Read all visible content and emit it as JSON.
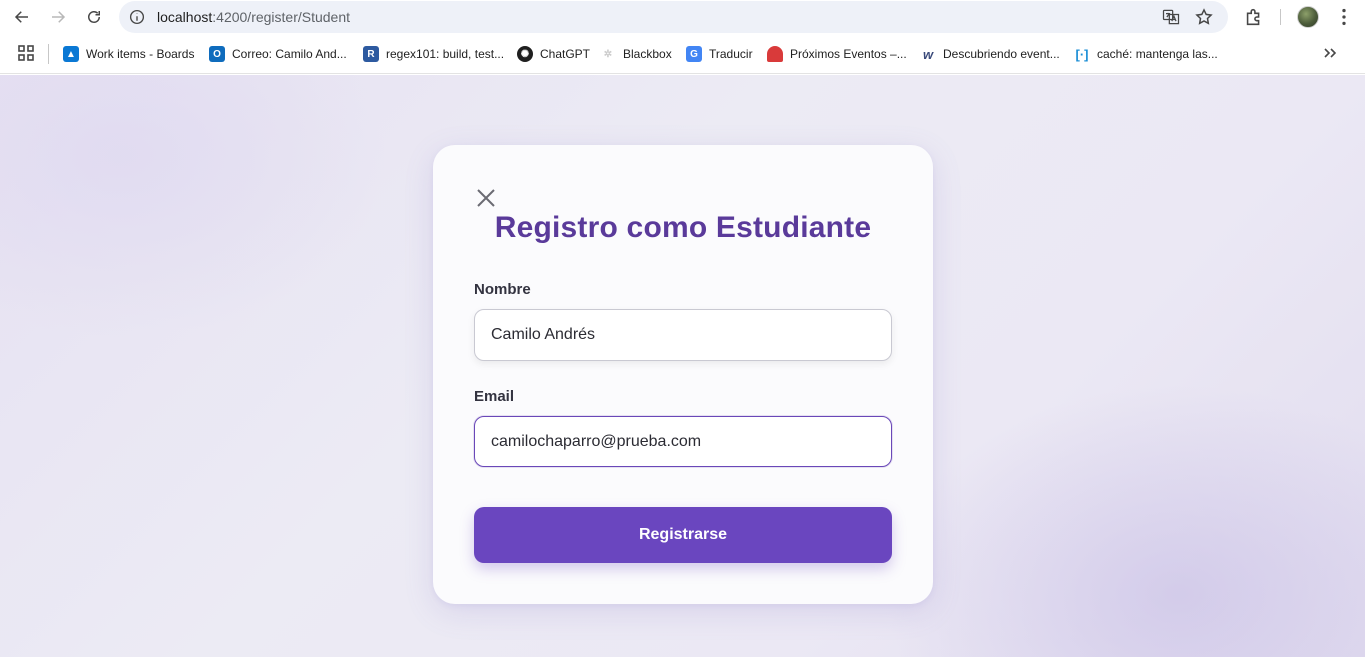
{
  "browser": {
    "url_host": "localhost",
    "url_path": ":4200/register/Student",
    "bookmarks": [
      {
        "label": "Work items - Boards",
        "icon": "azure-devops-icon",
        "color": "#0a78d4"
      },
      {
        "label": "Correo: Camilo And...",
        "icon": "outlook-icon",
        "color": "#0f6cbd"
      },
      {
        "label": "regex101: build, test...",
        "icon": "regex101-icon",
        "color": "#2d5aa0"
      },
      {
        "label": "ChatGPT",
        "icon": "chatgpt-icon",
        "color": "#1f1f1f"
      },
      {
        "label": "Blackbox",
        "icon": "blackbox-icon",
        "color": "#cccccc"
      },
      {
        "label": "Traducir",
        "icon": "google-translate-icon",
        "color": "#4285f4"
      },
      {
        "label": "Próximos Eventos –...",
        "icon": "watermelon-icon",
        "color": "#d93a3a"
      },
      {
        "label": "Descubriendo event...",
        "icon": "w-icon",
        "color": "#3a4a7a"
      },
      {
        "label": "caché: mantenga las...",
        "icon": "brackets-icon",
        "color": "#1d8fd6"
      }
    ]
  },
  "form": {
    "title": "Registro como Estudiante",
    "name_label": "Nombre",
    "name_value": "Camilo Andrés",
    "email_label": "Email",
    "email_value": "camilochaparro@prueba.com",
    "submit_label": "Registrarse"
  },
  "colors": {
    "accent": "#6a46bf",
    "title": "#5a3a9a"
  }
}
